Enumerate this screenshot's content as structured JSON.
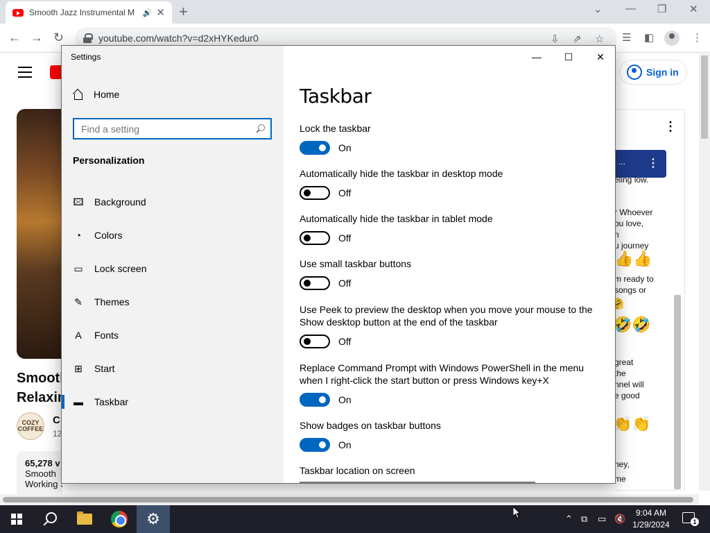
{
  "browser": {
    "tab_title": "Smooth Jazz Instrumental M",
    "url": "youtube.com/watch?v=d2xHYKedur0"
  },
  "youtube": {
    "sign_in_label": "Sign in",
    "video_title_line1": "Smooth",
    "video_title_line2": "Relaxin",
    "channel_logo_text": "COZY COFFEE",
    "channel_name": "C",
    "channel_subs": "12",
    "views": "65,278 v",
    "desc_line1": "Smooth",
    "desc_line2": "Working Studying",
    "chat": {
      "banner_dots": "...",
      "lines": [
        {
          "text": "eling low."
        },
        {
          "text": "r Whoever"
        },
        {
          "text": "ou love,"
        },
        {
          "text": "n"
        },
        {
          "text": "u journey"
        },
        {
          "text": "m ready to"
        },
        {
          "text": "songs or"
        },
        {
          "text": "great"
        },
        {
          "text": "the"
        },
        {
          "text": "nnel will"
        },
        {
          "text": "e good"
        },
        {
          "text": "ney,"
        },
        {
          "text": "me"
        }
      ],
      "emojis": [
        "👍👍",
        "👍",
        "🤗",
        "🤣🤣",
        "👏👏"
      ]
    }
  },
  "settings": {
    "window_title": "Settings",
    "home_label": "Home",
    "search_placeholder": "Find a setting",
    "section_heading": "Personalization",
    "nav_items": [
      {
        "label": "Background",
        "icon": "picture-icon"
      },
      {
        "label": "Colors",
        "icon": "palette-icon"
      },
      {
        "label": "Lock screen",
        "icon": "lock-screen-icon"
      },
      {
        "label": "Themes",
        "icon": "themes-icon"
      },
      {
        "label": "Fonts",
        "icon": "fonts-icon"
      },
      {
        "label": "Start",
        "icon": "start-icon"
      },
      {
        "label": "Taskbar",
        "icon": "taskbar-icon"
      }
    ],
    "active_nav": "Taskbar",
    "page_title": "Taskbar",
    "options": [
      {
        "label": "Lock the taskbar",
        "state": "On"
      },
      {
        "label": "Automatically hide the taskbar in desktop mode",
        "state": "Off"
      },
      {
        "label": "Automatically hide the taskbar in tablet mode",
        "state": "Off"
      },
      {
        "label": "Use small taskbar buttons",
        "state": "Off"
      },
      {
        "label": "Use Peek to preview the desktop when you move your mouse to the Show desktop button at the end of the taskbar",
        "state": "Off"
      },
      {
        "label": "Replace Command Prompt with Windows PowerShell in the menu when I right-click the start button or press Windows key+X",
        "state": "On"
      },
      {
        "label": "Show badges on taskbar buttons",
        "state": "On"
      }
    ],
    "location_label": "Taskbar location on screen",
    "accent_color": "#0067c0"
  },
  "taskbar": {
    "time": "9:04 AM",
    "date": "1/29/2024",
    "notification_count": "1"
  }
}
